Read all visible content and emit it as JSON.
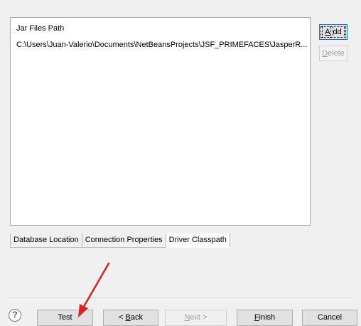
{
  "list": {
    "header": "Jar Files Path",
    "items": [
      "C:\\Users\\Juan-Valerio\\Documents\\NetBeansProjects\\JSF_PRIMEFACES\\JasperR..."
    ]
  },
  "side_buttons": {
    "add": {
      "mnemonic": "A",
      "rest": "dd"
    },
    "delete": {
      "mnemonic": "D",
      "rest": "elete"
    }
  },
  "tabs": [
    {
      "label": "Database Location",
      "active": false
    },
    {
      "label": "Connection Properties",
      "active": false
    },
    {
      "label": "Driver Classpath",
      "active": true
    }
  ],
  "footer": {
    "help_symbol": "?",
    "test": "Test",
    "back": {
      "prefix": "< ",
      "mnemonic": "B",
      "rest": "ack"
    },
    "next": {
      "mnemonic": "N",
      "rest": "ext >"
    },
    "finish": {
      "mnemonic": "F",
      "rest": "inish"
    },
    "cancel": "Cancel"
  },
  "annotation": {
    "arrow_color": "#e02020",
    "icon": "red-arrow-icon"
  }
}
